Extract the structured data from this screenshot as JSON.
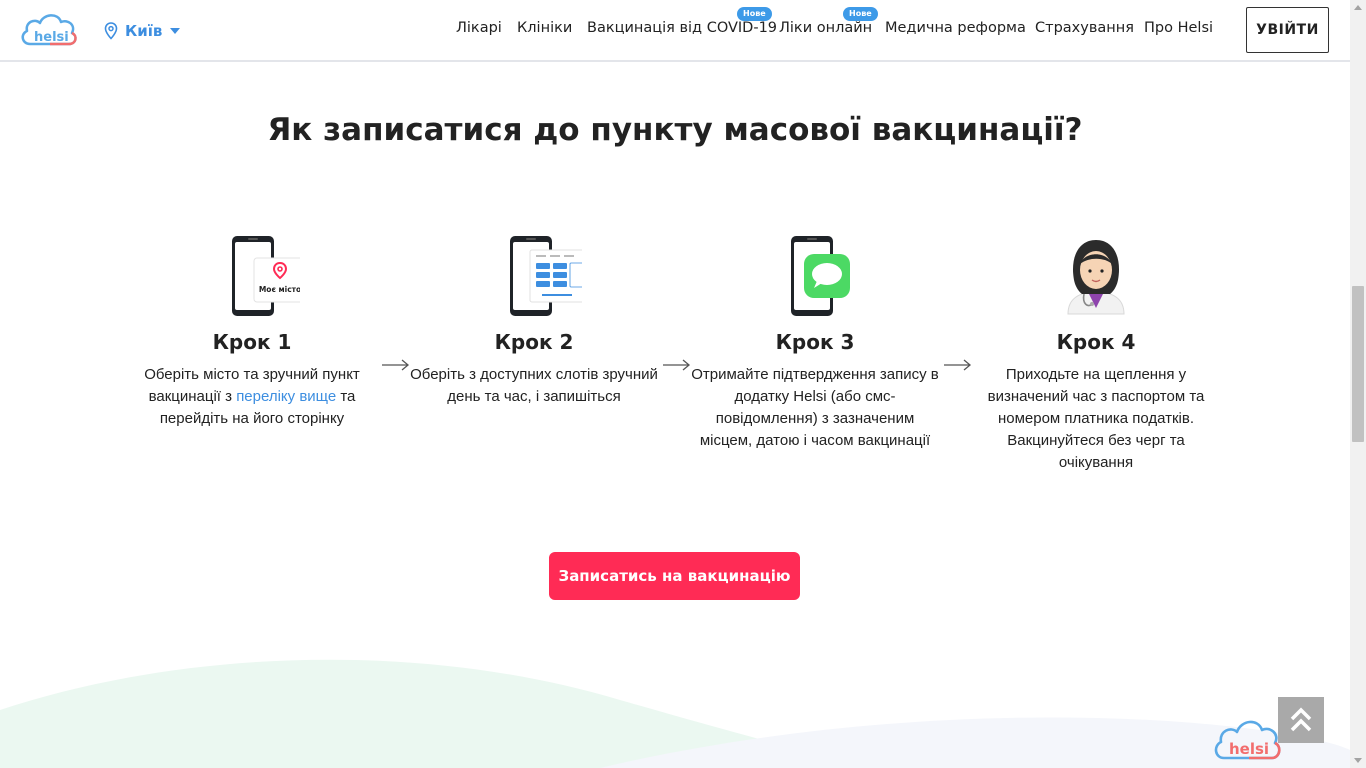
{
  "header": {
    "logo_text": "helsi",
    "city": "Київ",
    "nav": [
      {
        "label": "Лікарі"
      },
      {
        "label": "Клініки"
      },
      {
        "label": "Вакцинація від COVID-19",
        "badge": "Нове"
      },
      {
        "label": "Ліки онлайн",
        "badge": "Нове"
      },
      {
        "label": "Медична реформа"
      },
      {
        "label": "Страхування"
      },
      {
        "label": "Про Helsi"
      }
    ],
    "login_label": "УВІЙТИ"
  },
  "main": {
    "title": "Як записатися до пункту масової вакцинації?",
    "steps": [
      {
        "title": "Крок 1",
        "text_before": "Оберіть місто та зручний пункт вакцинації з ",
        "link": "переліку вище",
        "text_after": " та перейдіть на його сторінку",
        "icon_caption": "Моє місто",
        "icon": "phone-map-pin-icon"
      },
      {
        "title": "Крок 2",
        "text": "Оберіть з доступних слотів зручний день та час, і запишіться",
        "icon": "phone-time-slots-icon"
      },
      {
        "title": "Крок 3",
        "text": "Отримайте підтвердження запису в додатку Helsi (або смс-повідомлення) з зазначеним місцем, датою і часом вакцинації",
        "icon": "phone-message-icon"
      },
      {
        "title": "Крок 4",
        "text": "Приходьте на щеплення у визначений час з паспортом та номером платника податків. Вакцинуйтеся без черг та очікування",
        "icon": "doctor-icon"
      }
    ],
    "cta_label": "Записатись на вакцинацію"
  },
  "colors": {
    "accent_blue": "#3d8ee0",
    "cta_red": "#ff2b55",
    "badge_blue": "#3d9ae8",
    "logo_blue": "#5aa9e6",
    "logo_red": "#f26d6d"
  },
  "footer": {
    "logo_text": "helsi"
  }
}
